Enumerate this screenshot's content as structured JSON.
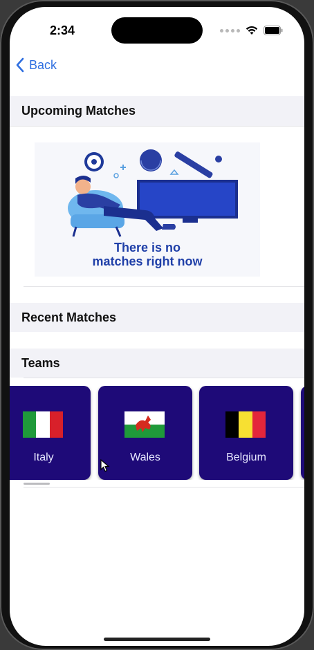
{
  "status_bar": {
    "time": "2:34",
    "icons": [
      "signal-dots-icon",
      "wifi-icon",
      "battery-icon"
    ]
  },
  "nav": {
    "back_label": "Back"
  },
  "sections": {
    "upcoming": "Upcoming Matches",
    "recent": "Recent Matches",
    "teams": "Teams"
  },
  "upcoming_illustration": {
    "message_line1": "There is no",
    "message_line2": "matches right now"
  },
  "teams": [
    {
      "name": "Italy",
      "flag": "italy"
    },
    {
      "name": "Wales",
      "flag": "wales"
    },
    {
      "name": "Belgium",
      "flag": "belgium"
    }
  ],
  "colors": {
    "accent": "#2f6fe0",
    "card_bg": "#1e0a78",
    "header_bg": "#f2f2f7"
  }
}
